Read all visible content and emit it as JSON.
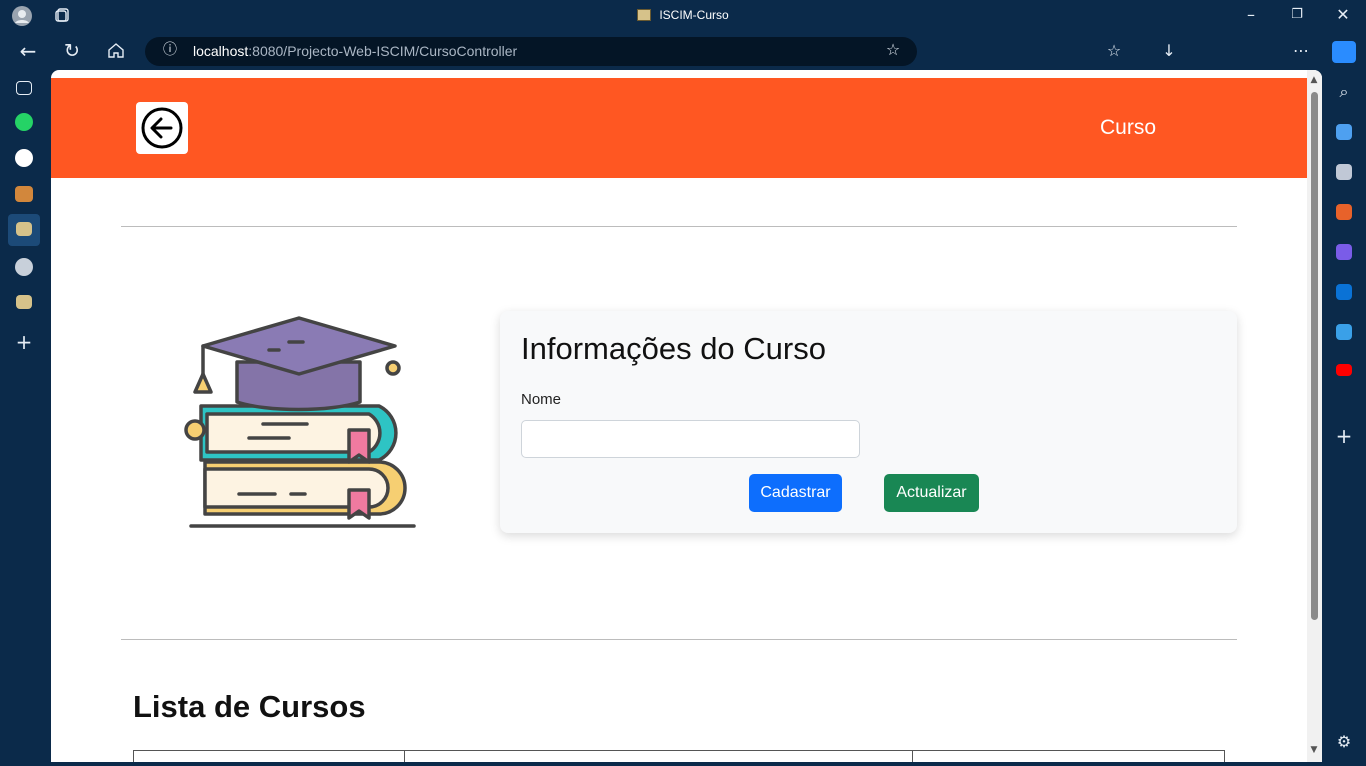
{
  "window": {
    "title": "ISCIM-Curso"
  },
  "browser": {
    "url_host": "localhost",
    "url_rest": ":8080/Projecto-Web-ISCIM/CursoController"
  },
  "header": {
    "brand": "Curso",
    "accent": "#ff5722"
  },
  "form": {
    "title": "Informações do Curso",
    "name_label": "Nome",
    "name_value": "",
    "register_label": "Cadastrar",
    "update_label": "Actualizar",
    "register_color": "#0d6efd",
    "update_color": "#198754"
  },
  "list": {
    "title": "Lista de Cursos"
  }
}
